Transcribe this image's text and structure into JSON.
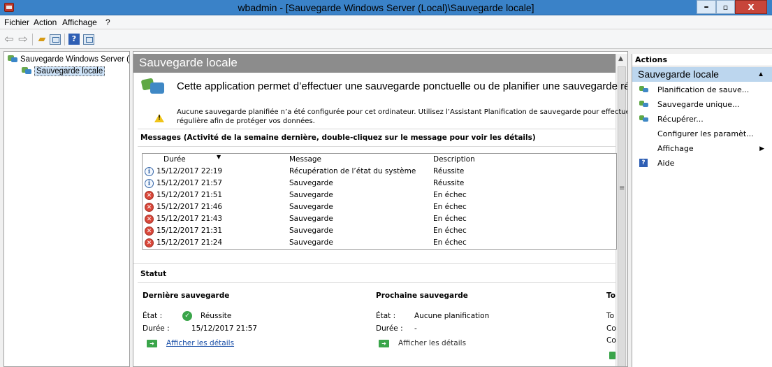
{
  "window": {
    "title": "wbadmin - [Sauvegarde Windows Server (Local)\\Sauvegarde locale]",
    "controls": [
      "–",
      "▫",
      "x"
    ]
  },
  "menu": [
    "Fichier",
    "Action",
    "Affichage",
    "?"
  ],
  "toolbar": {
    "icons": [
      "back-arrow-icon",
      "forward-arrow-icon",
      "up-folder-icon",
      "show-hide-tree-icon",
      "help-icon",
      "action-pane-icon"
    ]
  },
  "tree": {
    "items": [
      {
        "label": "Sauvegarde Windows Server (Local)"
      },
      {
        "label": "Sauvegarde locale"
      }
    ]
  },
  "center": {
    "header": "Sauvegarde locale",
    "intro": "Cette application permet d’effectuer une sauvegarde ponctuelle ou de planifier une sauvegarde régulière.",
    "warning_line1": "Aucune sauvegarde planifiée n’a été configurée pour cet ordinateur. Utilisez l’Assistant Planification de sauvegarde pour effectuer une sauvegarde",
    "warning_line2": "régulière afin de protéger vos données.",
    "messages_title": "Messages (Activité de la semaine dernière, double-cliquez sur le message pour voir les détails)",
    "columns": {
      "duree": "Durée",
      "message": "Message",
      "description": "Description"
    },
    "rows": [
      {
        "icon": "info",
        "duree": "15/12/2017 22:19",
        "message": "Récupération de l’état du système",
        "description": "Réussite"
      },
      {
        "icon": "info",
        "duree": "15/12/2017 21:57",
        "message": "Sauvegarde",
        "description": "Réussite"
      },
      {
        "icon": "error",
        "duree": "15/12/2017 21:51",
        "message": "Sauvegarde",
        "description": "En échec"
      },
      {
        "icon": "error",
        "duree": "15/12/2017 21:46",
        "message": "Sauvegarde",
        "description": "En échec"
      },
      {
        "icon": "error",
        "duree": "15/12/2017 21:43",
        "message": "Sauvegarde",
        "description": "En échec"
      },
      {
        "icon": "error",
        "duree": "15/12/2017 21:31",
        "message": "Sauvegarde",
        "description": "En échec"
      },
      {
        "icon": "error",
        "duree": "15/12/2017 21:24",
        "message": "Sauvegarde",
        "description": "En échec"
      }
    ],
    "status": {
      "title": "Statut",
      "last": {
        "title": "Dernière sauvegarde",
        "etat_label": "État :",
        "etat_value": "Réussite",
        "duree_label": "Durée :",
        "duree_value": "15/12/2017 21:57",
        "link": "Afficher les détails"
      },
      "next": {
        "title": "Prochaine sauvegarde",
        "etat_label": "État :",
        "etat_value": "Aucune planification",
        "duree_label": "Durée :",
        "duree_value": "-",
        "link": "Afficher les détails"
      },
      "third_col": {
        "title": "To",
        "line1": "To",
        "line2": "Co",
        "line3": "Co"
      }
    }
  },
  "actions": {
    "title": "Actions",
    "group": "Sauvegarde locale",
    "items": [
      {
        "label": "Planification de sauve...",
        "icon": "backup-schedule-icon"
      },
      {
        "label": "Sauvegarde unique...",
        "icon": "backup-once-icon"
      },
      {
        "label": "Récupérer...",
        "icon": "recover-icon"
      },
      {
        "label": "Configurer les paramèt...",
        "icon": ""
      },
      {
        "label": "Affichage",
        "icon": "",
        "submenu": "▶"
      },
      {
        "label": "Aide",
        "icon": "help-icon"
      }
    ]
  },
  "colors": {
    "titlebar": "#3a82c8",
    "header_gray": "#8c8c8c",
    "action_group": "#bcd6ee",
    "error_red": "#d9473a",
    "success_green": "#3aa54a",
    "link_blue": "#1a4fa8"
  }
}
